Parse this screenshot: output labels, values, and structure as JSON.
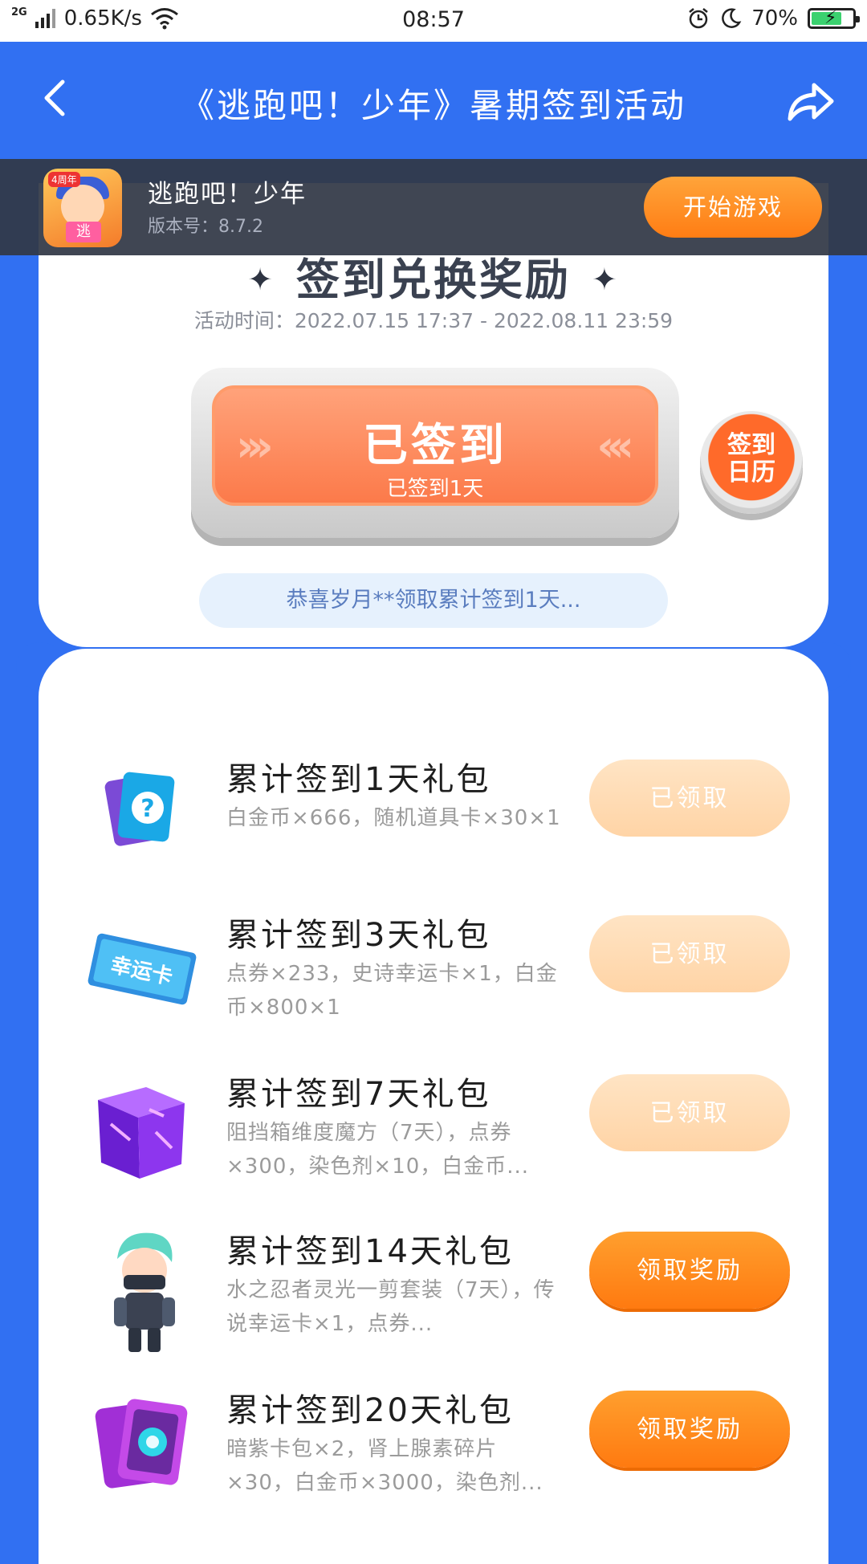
{
  "status_bar": {
    "network": "2G",
    "speed": "0.65K/s",
    "time": "08:57",
    "battery": "70%"
  },
  "header": {
    "title": "《逃跑吧！少年》暑期签到活动"
  },
  "banner": {
    "app_name": "逃跑吧！少年",
    "version": "版本号：8.7.2",
    "icon_tag": "4周年",
    "icon_sign": "逃",
    "start_label": "开始游戏"
  },
  "checkin": {
    "section_title": "签到兑换奖励",
    "activity_time": "活动时间：2022.07.15 17:37 - 2022.08.11 23:59",
    "button_label": "已签到",
    "button_sub": "已签到1天",
    "calendar_line1": "签到",
    "calendar_line2": "日历",
    "marquee": "恭喜岁月**领取累计签到1天..."
  },
  "rewards": [
    {
      "name": "累计签到1天礼包",
      "desc": "白金币×666，随机道具卡×30×1",
      "button": "已领取",
      "state": "claimed",
      "icon": "mystery-card-icon"
    },
    {
      "name": "累计签到3天礼包",
      "desc": "点券×233，史诗幸运卡×1，白金币×800×1",
      "button": "已领取",
      "state": "claimed",
      "icon": "lucky-card-icon",
      "icon_text": "幸运卡"
    },
    {
      "name": "累计签到7天礼包",
      "desc": "阻挡箱维度魔方（7天），点券×300，染色剂×10，白金币...",
      "button": "已领取",
      "state": "claimed",
      "icon": "magic-cube-icon"
    },
    {
      "name": "累计签到14天礼包",
      "desc": "水之忍者灵光一剪套装（7天），传说幸运卡×1，点券...",
      "button": "领取奖励",
      "state": "active",
      "icon": "ninja-character-icon"
    },
    {
      "name": "累计签到20天礼包",
      "desc": "暗紫卡包×2，肾上腺素碎片×30，白金币×3000，染色剂...",
      "button": "领取奖励",
      "state": "active",
      "icon": "card-pack-icon"
    }
  ],
  "colors": {
    "primary_blue": "#3170F2",
    "orange": "#FF8A1F",
    "claimed": "#FFDDB8"
  }
}
